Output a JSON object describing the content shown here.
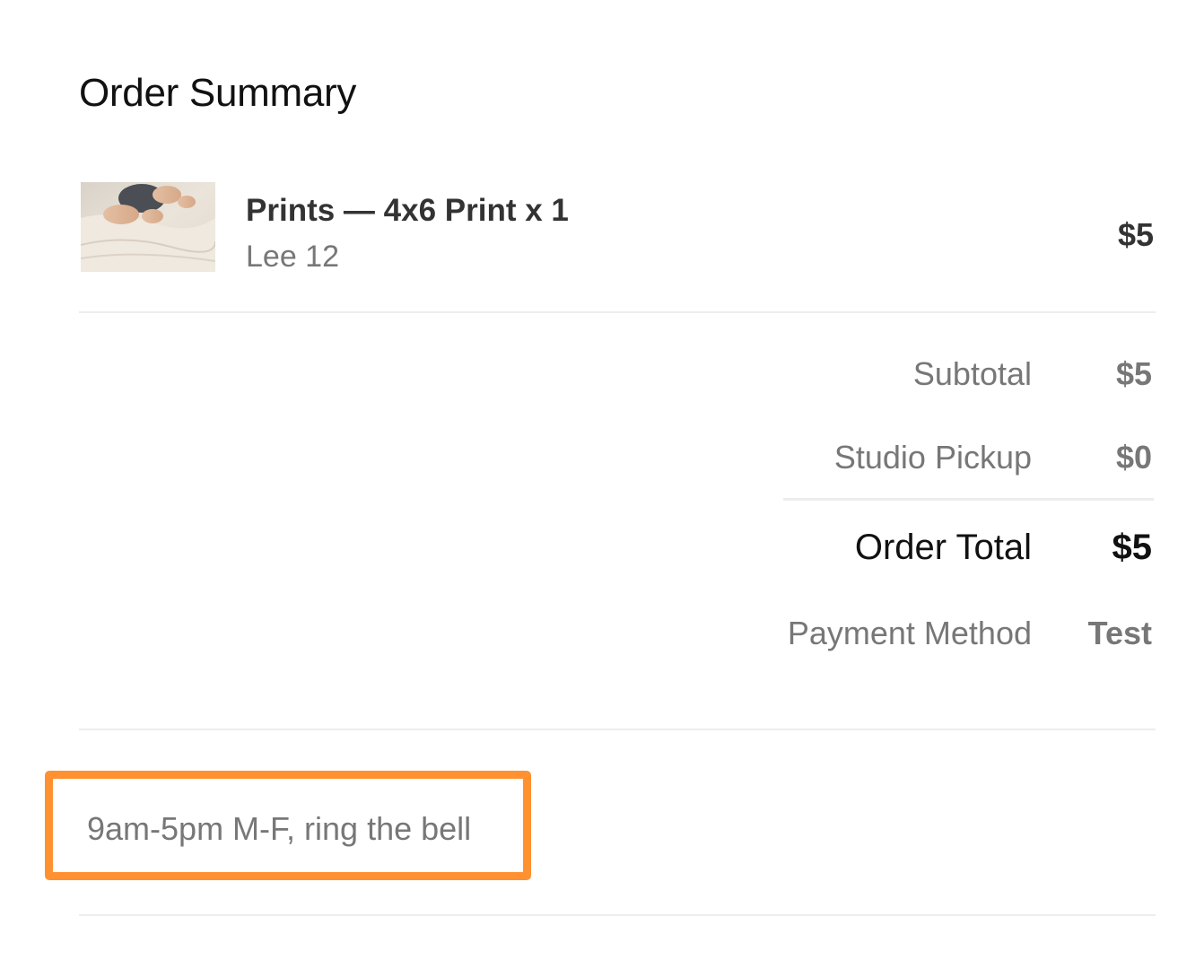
{
  "header": {
    "title": "Order Summary"
  },
  "item": {
    "name": "Prints — 4x6 Print x 1",
    "subtitle": "Lee 12",
    "price": "$5",
    "thumbnail_icon": "baby-photo-thumbnail"
  },
  "summary": {
    "subtotal_label": "Subtotal",
    "subtotal_value": "$5",
    "shipping_label": "Studio Pickup",
    "shipping_value": "$0",
    "total_label": "Order Total",
    "total_value": "$5",
    "payment_label": "Payment Method",
    "payment_value": "Test"
  },
  "note": {
    "text": "9am-5pm M-F, ring the bell",
    "highlight_color": "#ff9130"
  }
}
